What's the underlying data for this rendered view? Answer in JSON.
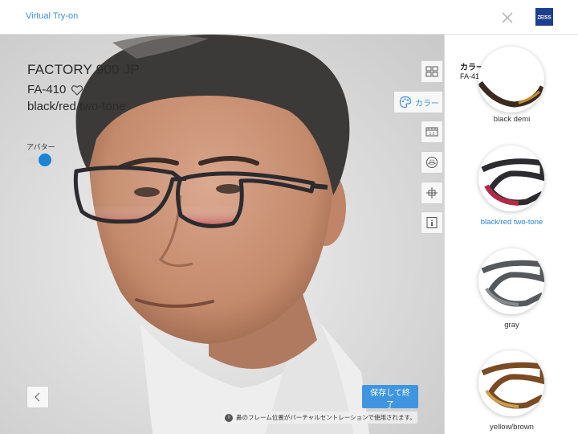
{
  "header": {
    "title": "Virtual Try-on",
    "logo_text": "ZEISS"
  },
  "viewer": {
    "brand": "FACTORY 900 JP",
    "model": "FA-410",
    "color_name": "black/red two-tone",
    "avatar_label": "アバター",
    "avatar_on": true,
    "color_button_label": "カラー",
    "save_button_label": "保存して終了",
    "notice_text": "鼻のフレーム位置がバーチャルセントレーションで使用されます。",
    "tools": [
      "compare-icon",
      "palette-icon",
      "ruler-icon",
      "lens-icon",
      "fit-icon",
      "info-icon"
    ]
  },
  "panel": {
    "title": "カラーオプション",
    "subtitle": "FA-410",
    "options": [
      {
        "label": "black demi",
        "selected": false,
        "color": "#3a2a20"
      },
      {
        "label": "black/red two-tone",
        "selected": true,
        "color": "#2c2c30"
      },
      {
        "label": "gray",
        "selected": false,
        "color": "#55585c"
      },
      {
        "label": "yellow/brown",
        "selected": false,
        "color": "#7a4a22"
      }
    ]
  },
  "colors": {
    "accent": "#3f95e0",
    "link": "#3a8ed6"
  }
}
